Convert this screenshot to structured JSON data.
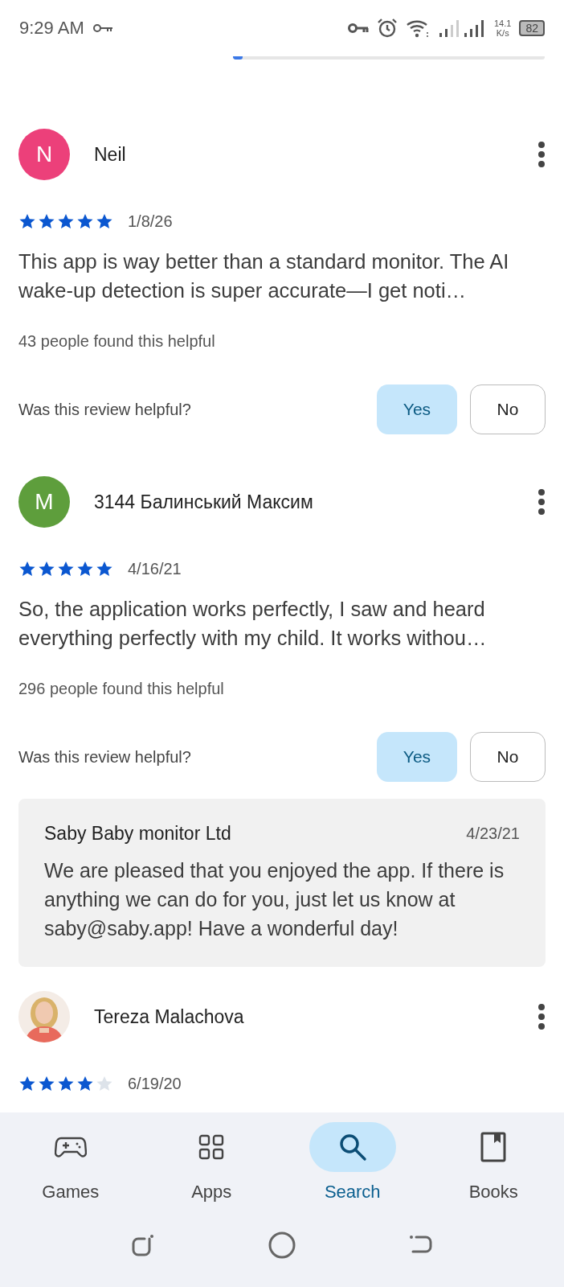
{
  "status_bar": {
    "time": "9:29 AM",
    "speed_value": "14.1",
    "speed_unit": "K/s",
    "battery": "82"
  },
  "rating_bar": {
    "level": 0.03
  },
  "reviews": [
    {
      "avatar": {
        "kind": "letter",
        "letter": "N",
        "color": "#ec407a"
      },
      "name": "Neil",
      "stars": 5,
      "date": "1/8/26",
      "text": "This app is way better than a standard monitor. The AI wake-up detection is super accurate—I get noti…",
      "helpful_count": "43 people found this helpful",
      "question": "Was this review helpful?",
      "buttons": [
        {
          "label": "Yes",
          "selected": true
        },
        {
          "label": "No",
          "selected": false
        }
      ]
    },
    {
      "avatar": {
        "kind": "letter",
        "letter": "M",
        "color": "#5e9e3c"
      },
      "name": "3144 Балинський Максим",
      "stars": 5,
      "date": "4/16/21",
      "text": "So, the application works perfectly, I saw and heard everything perfectly with my child. It works withou…",
      "helpful_count": "296 people found this helpful",
      "question": "Was this review helpful?",
      "buttons": [
        {
          "label": "Yes",
          "selected": true
        },
        {
          "label": "No",
          "selected": false
        }
      ],
      "reply": {
        "author": "Saby Baby monitor Ltd",
        "date": "4/23/21",
        "text": "We are pleased that you enjoyed the app. If there is anything we can do for you, just let us know at saby@saby.app! Have a wonderful day!"
      }
    },
    {
      "name": "Tereza Malachova",
      "stars": 4,
      "date": "6/19/20"
    }
  ],
  "nav_tabs": [
    {
      "kind": "games",
      "label": "Games",
      "selected": false
    },
    {
      "kind": "apps",
      "label": "Apps",
      "selected": false
    },
    {
      "kind": "search",
      "label": "Search",
      "selected": true
    },
    {
      "kind": "books",
      "label": "Books",
      "selected": false
    }
  ]
}
